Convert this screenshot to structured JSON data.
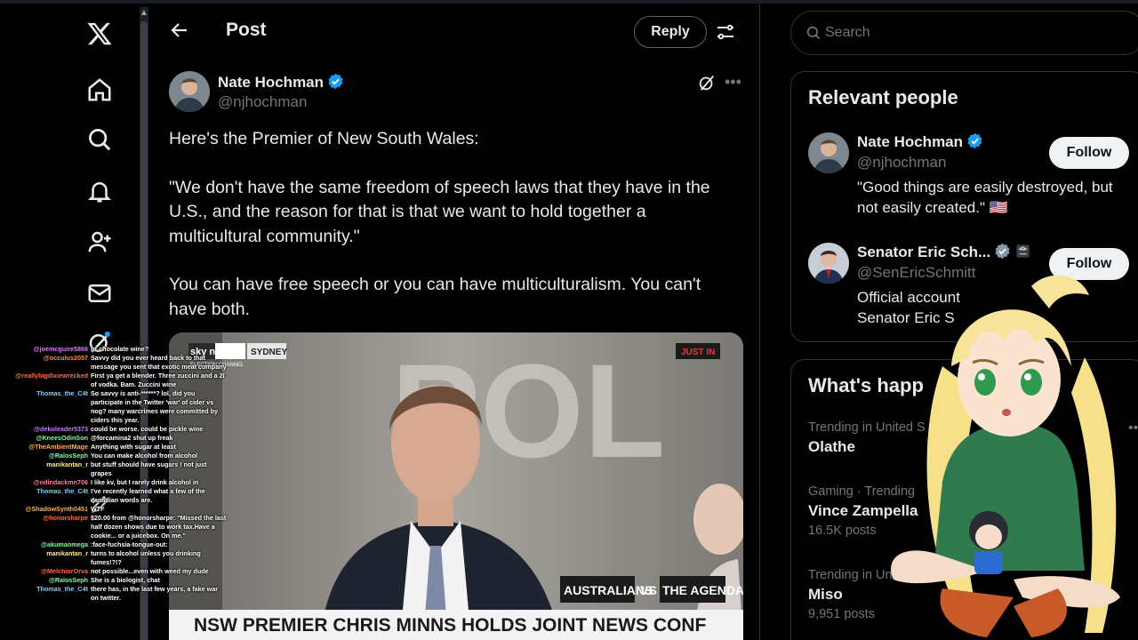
{
  "nav": {
    "items": [
      "x-logo-icon",
      "home-icon",
      "explore-icon",
      "notifications-icon",
      "follow-icon",
      "messages-icon",
      "grok-icon"
    ]
  },
  "header": {
    "title": "Post",
    "reply_label": "Reply"
  },
  "post": {
    "author_name": "Nate Hochman",
    "author_handle": "@njhochman",
    "paragraphs": [
      "Here's the Premier of New South Wales:",
      "\"We don't have the same freedom of speech laws that they have in the U.S., and the reason for that is that we want to hold together a multicultural community.\"",
      "You can have free speech or you can have multiculturalism. You can't have both."
    ],
    "media": {
      "channel_logo": "sky news",
      "location": "SYDNEY",
      "sub_logo": "ELECTION CHANNEL",
      "badge": "JUST IN",
      "show_left": "AUSTRALIANS",
      "show_vs": "VS",
      "show_right": "THE AGENDA",
      "ticker": "NSW PREMIER CHRIS MINNS HOLDS JOINT NEWS CONF",
      "wall_text": "POL"
    }
  },
  "search": {
    "placeholder": "Search"
  },
  "relevant": {
    "title": "Relevant people",
    "people": [
      {
        "name": "Nate Hochman",
        "handle": "@njhochman",
        "bio": "\"Good things are easily destroyed, but not easily created.\" 🇺🇸",
        "follow_label": "Follow"
      },
      {
        "name": "Senator Eric Sch...",
        "handle": "@SenEricSchmitt",
        "bio": "Official account Senator Eric S",
        "follow_label": "Follow"
      }
    ]
  },
  "trends": {
    "title": "What's happ",
    "items": [
      {
        "meta": "Trending in United S",
        "name": "Olathe",
        "count": ""
      },
      {
        "meta": "Gaming · Trending",
        "name": "Vince Zampella",
        "count": "16.5K posts"
      },
      {
        "meta": "Trending in Un",
        "name": "Miso",
        "count": "9,951 posts"
      }
    ]
  },
  "chat": [
    {
      "user": "@joemcguire5866",
      "msg": "or chocolate wine?",
      "color": "#e07cff"
    },
    {
      "user": "@occulus2057",
      "msg": "Savvy did you ever heard back to that message you sent that exotic meat company",
      "color": "#ff8c4a"
    },
    {
      "user": "@reallybigdixiewrecked",
      "msg": "First ya get a blender. Three zuccini and a 2l of vodka. Bam. Zuccini wine",
      "color": "#ff6a4a"
    },
    {
      "user": "Thomas_the_C4t",
      "msg": "So savvy is anti-******? lol, did you participate in the Twitter 'war' of cider vs nog? many warcrimes were committed by ciders this year.",
      "color": "#7fd0ff"
    },
    {
      "user": "@dekuleader5373",
      "msg": "could be worse. could be pickle wine",
      "color": "#c07cff"
    },
    {
      "user": "@KneesOdinSon",
      "msg": "@forcamina2 shut up freak",
      "color": "#7cffa0"
    },
    {
      "user": "@TheAmbientMage",
      "msg": "Anything with sugar at least",
      "color": "#ffb04a"
    },
    {
      "user": "@RalosSeph",
      "msg": "You can make alcohol from alcohol",
      "color": "#7cffa0"
    },
    {
      "user": "manikantan_r",
      "msg": "but stuff should have sugars ! not just grapes",
      "color": "#fff27c"
    },
    {
      "user": "@odindackmn706",
      "msg": "I like kv, but I rarely drink alcohol in",
      "color": "#ff7ca0"
    },
    {
      "user": "Thomas_the_C4t",
      "msg": "I've recently learned what a few of the canadian words are.",
      "color": "#7fd0ff"
    },
    {
      "user": "@ShadowSynth0451",
      "msg": "WTF",
      "color": "#ffb04a"
    },
    {
      "user": "@honorsharpe",
      "msg": "$20.00 from @honorsharpe: \"Missed the last half dozen shows due to work tax.Have a cookie... or a juicebox. On me.\"",
      "color": "#ff6a4a"
    },
    {
      "user": "@akumaomega",
      "msg": ":face-fuchsia-tongue-out:",
      "color": "#7cffa0"
    },
    {
      "user": "manikantan_r",
      "msg": "turns to alcohol unless you drinking fumes!?!?",
      "color": "#fff27c"
    },
    {
      "user": "@MelchiorOrva",
      "msg": "not possible...even with weed my dude",
      "color": "#ff6a4a"
    },
    {
      "user": "@RalosSeph",
      "msg": "She is a biologist, chat",
      "color": "#7cffa0"
    },
    {
      "user": "Thomas_the_C4t",
      "msg": "there has, in the last few years, a fake war on twitter.",
      "color": "#7fd0ff"
    }
  ]
}
